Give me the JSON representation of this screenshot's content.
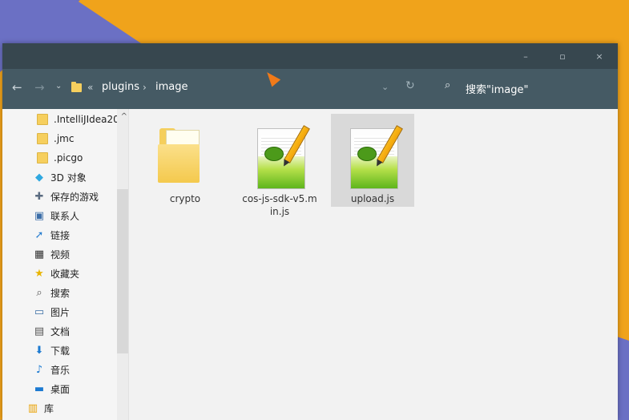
{
  "window": {
    "controls": {
      "minimize": "–",
      "maximize": "▫",
      "close": "×"
    }
  },
  "address": {
    "back": "←",
    "forward": "→",
    "history": "⌄",
    "overflow": "«",
    "breadcrumb": [
      "plugins",
      "image"
    ],
    "separator": "›",
    "dropdown": "⌄",
    "refresh": "↻",
    "search_icon": "⌕",
    "search_text": "搜索\"image\""
  },
  "sidebar": {
    "items": [
      {
        "label": ".IntelliJIdea20",
        "icon": "folder-icon"
      },
      {
        "label": ".jmc",
        "icon": "folder-icon"
      },
      {
        "label": ".picgo",
        "icon": "folder-icon"
      },
      {
        "label": "3D 对象",
        "icon": "cube-icon"
      },
      {
        "label": "保存的游戏",
        "icon": "gamepad-icon"
      },
      {
        "label": "联系人",
        "icon": "contacts-icon"
      },
      {
        "label": "链接",
        "icon": "link-icon"
      },
      {
        "label": "视频",
        "icon": "video-icon"
      },
      {
        "label": "收藏夹",
        "icon": "star-icon"
      },
      {
        "label": "搜索",
        "icon": "search-icon"
      },
      {
        "label": "图片",
        "icon": "picture-icon"
      },
      {
        "label": "文档",
        "icon": "document-icon"
      },
      {
        "label": "下载",
        "icon": "download-icon"
      },
      {
        "label": "音乐",
        "icon": "music-icon"
      },
      {
        "label": "桌面",
        "icon": "desktop-icon"
      },
      {
        "label": "库",
        "icon": "library-icon"
      }
    ],
    "collapse_icon": "^"
  },
  "files": [
    {
      "name": "crypto",
      "type": "folder"
    },
    {
      "name": "cos-js-sdk-v5.min.js",
      "line1": "cos-js-sdk-v5.m",
      "line2": "in.js",
      "type": "notepad"
    },
    {
      "name": "upload.js",
      "type": "notepad",
      "selected": true
    }
  ]
}
